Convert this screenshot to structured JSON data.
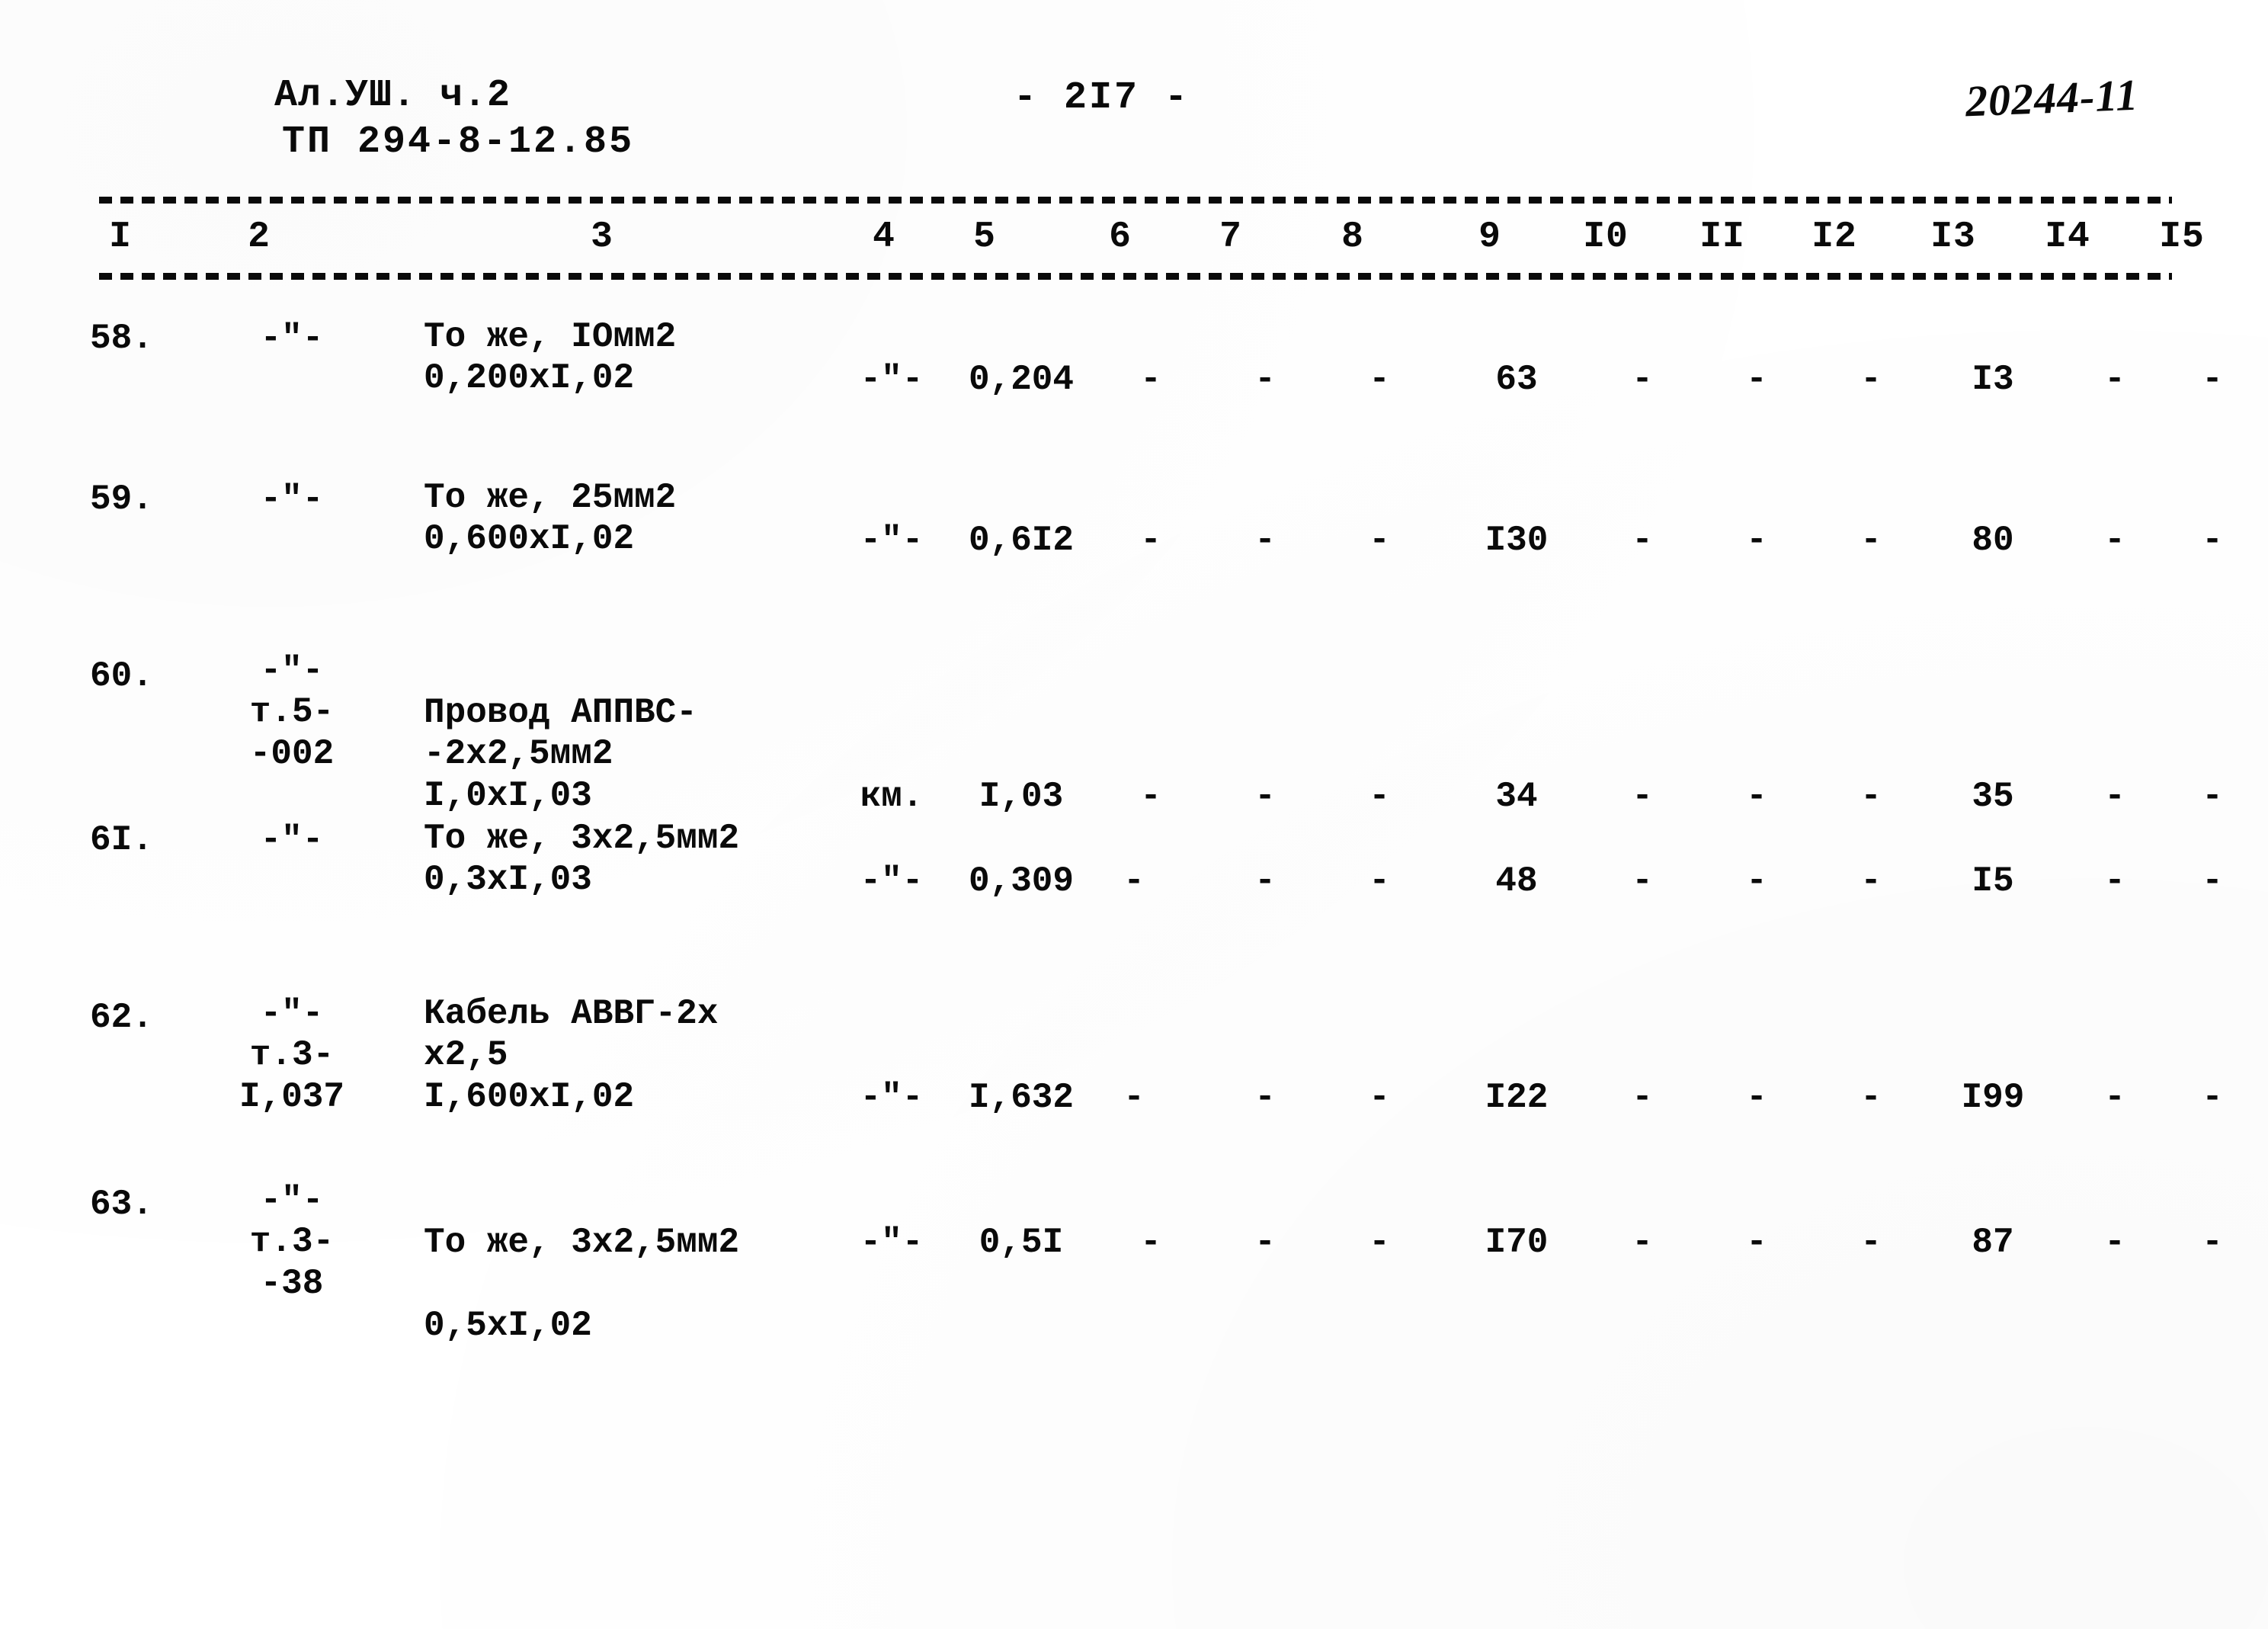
{
  "document": {
    "album_line": "Ал.УШ.  ч.2",
    "project_code": "ТП 294-8-12.85",
    "page_number": "- 2I7 -",
    "stamp_number": "20244-11"
  },
  "table": {
    "column_headers": [
      "I",
      "2",
      "3",
      "4",
      "5",
      "6",
      "7",
      "8",
      "9",
      "I0",
      "II",
      "I2",
      "I3",
      "I4",
      "I5"
    ],
    "rows": [
      {
        "c1": "58.",
        "c2": "-\"-",
        "c3": "То же, IОмм2\n0,200xI,02",
        "c4": "-\"-",
        "c5": "0,204",
        "c6": "-",
        "c7": "-",
        "c8": "-",
        "c9": "63",
        "c10": "-",
        "c11": "-",
        "c12": "-",
        "c13": "I3",
        "c14": "-",
        "c15": "-"
      },
      {
        "c1": "59.",
        "c2": "-\"-",
        "c3": "То же, 25мм2\n0,600xI,02",
        "c4": "-\"-",
        "c5": "0,6I2",
        "c6": "-",
        "c7": "-",
        "c8": "-",
        "c9": "I30",
        "c10": "-",
        "c11": "-",
        "c12": "-",
        "c13": "80",
        "c14": "-",
        "c15": "-"
      },
      {
        "c1": "60.",
        "c2": "-\"-\nт.5-\n-002",
        "c3": "Провод АППВС-\n-2х2,5мм2\nI,0xI,03",
        "c4": "км.",
        "c5": "I,03",
        "c6": "-",
        "c7": "-",
        "c8": "-",
        "c9": "34",
        "c10": "-",
        "c11": "-",
        "c12": "-",
        "c13": "35",
        "c14": "-",
        "c15": "-"
      },
      {
        "c1": "6I.",
        "c2": "-\"-",
        "c3": "То же, 3х2,5мм2\n0,3xI,03",
        "c4": "-\"-",
        "c5": "0,309",
        "c6": "-",
        "c7": "-",
        "c8": "-",
        "c9": "48",
        "c10": "-",
        "c11": "-",
        "c12": "-",
        "c13": "I5",
        "c14": "-",
        "c15": "-"
      },
      {
        "c1": "62.",
        "c2": "-\"-\nт.3-\nI,037",
        "c3": "Кабель АВВГ-2х\nх2,5\nI,600xI,02",
        "c4": "-\"-",
        "c5": "I,632",
        "c6": "-",
        "c7": "-",
        "c8": "-",
        "c9": "I22",
        "c10": "-",
        "c11": "-",
        "c12": "-",
        "c13": "I99",
        "c14": "-",
        "c15": "-"
      },
      {
        "c1": "63.",
        "c2": "-\"-\nт.3-\n-38",
        "c3": "То же, 3х2,5мм2\n\n0,5xI,02",
        "c4": "-\"-",
        "c5": "0,5I",
        "c6": "-",
        "c7": "-",
        "c8": "-",
        "c9": "I70",
        "c10": "-",
        "c11": "-",
        "c12": "-",
        "c13": "87",
        "c14": "-",
        "c15": "-"
      }
    ]
  }
}
